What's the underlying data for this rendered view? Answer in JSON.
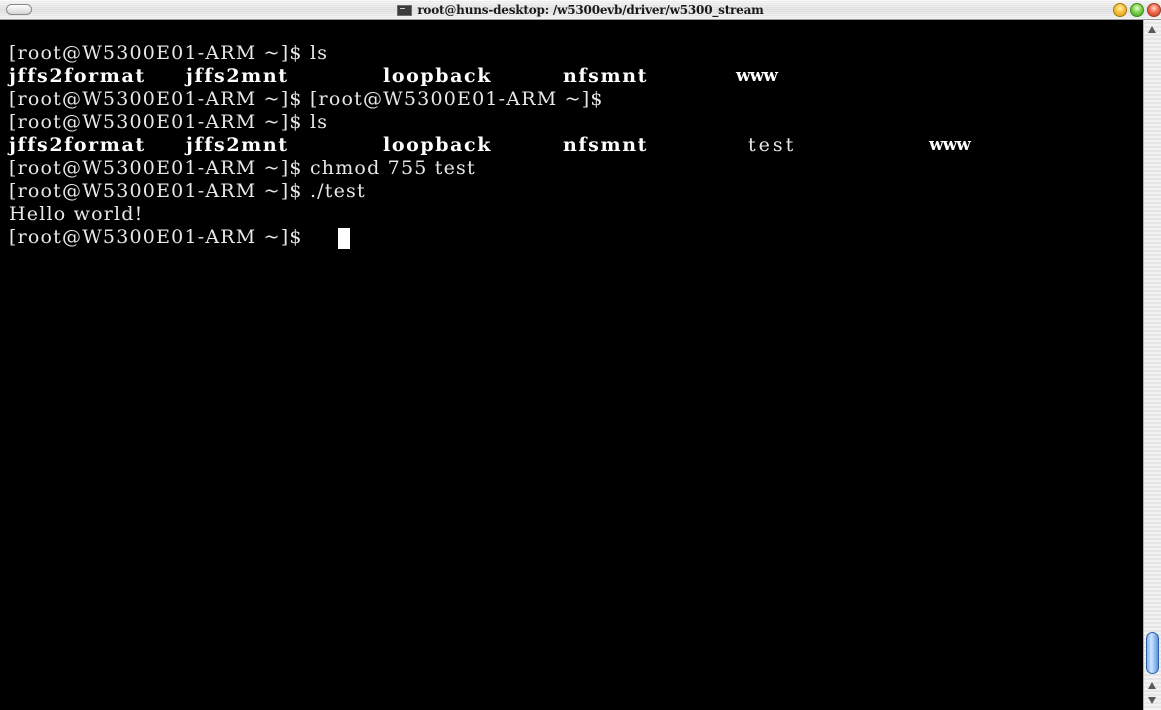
{
  "window": {
    "title": "root@huns-desktop: /w5300evb/driver/w5300_stream"
  },
  "icons": {
    "toolbar_toggle": "toolbar-pill-icon",
    "terminal": "terminal-icon",
    "minimize": "minimize-button",
    "zoom": "zoom-button",
    "close": "close-button"
  },
  "colors": {
    "terminal_background": "#000000",
    "terminal_text": "#e8e8e8",
    "scroll_thumb": "#7fb0ec"
  },
  "terminal": {
    "lines": [
      {
        "segments": [
          {
            "text": "[root@W5300E01-ARM ~]$ ls",
            "bold": false
          }
        ]
      },
      {
        "segments": [
          {
            "text": "jffs2format",
            "bold": true
          },
          {
            "text": "jffs2mnt",
            "bold": true
          },
          {
            "text": "loopback",
            "bold": true
          },
          {
            "text": "nfsmnt",
            "bold": true
          },
          {
            "text": "www",
            "bold": true
          }
        ]
      },
      {
        "segments": [
          {
            "text": "[root@W5300E01-ARM ~]$ [root@W5300E01-ARM ~]$",
            "bold": false
          }
        ]
      },
      {
        "segments": [
          {
            "text": "[root@W5300E01-ARM ~]$ ls",
            "bold": false
          }
        ]
      },
      {
        "segments": [
          {
            "text": "jffs2format",
            "bold": true
          },
          {
            "text": "jffs2mnt",
            "bold": true
          },
          {
            "text": "loopback",
            "bold": true
          },
          {
            "text": "nfsmnt",
            "bold": true
          },
          {
            "text": "test",
            "bold": false
          },
          {
            "text": "www",
            "bold": true
          }
        ]
      },
      {
        "segments": [
          {
            "text": "[root@W5300E01-ARM ~]$ chmod 755 test",
            "bold": false
          }
        ]
      },
      {
        "segments": [
          {
            "text": "[root@W5300E01-ARM ~]$ ./test",
            "bold": false
          }
        ]
      },
      {
        "segments": [
          {
            "text": "Hello world!",
            "bold": false
          }
        ]
      },
      {
        "segments": [
          {
            "text": "[root@W5300E01-ARM ~]$ ",
            "bold": false
          }
        ],
        "cursor": true
      }
    ]
  }
}
